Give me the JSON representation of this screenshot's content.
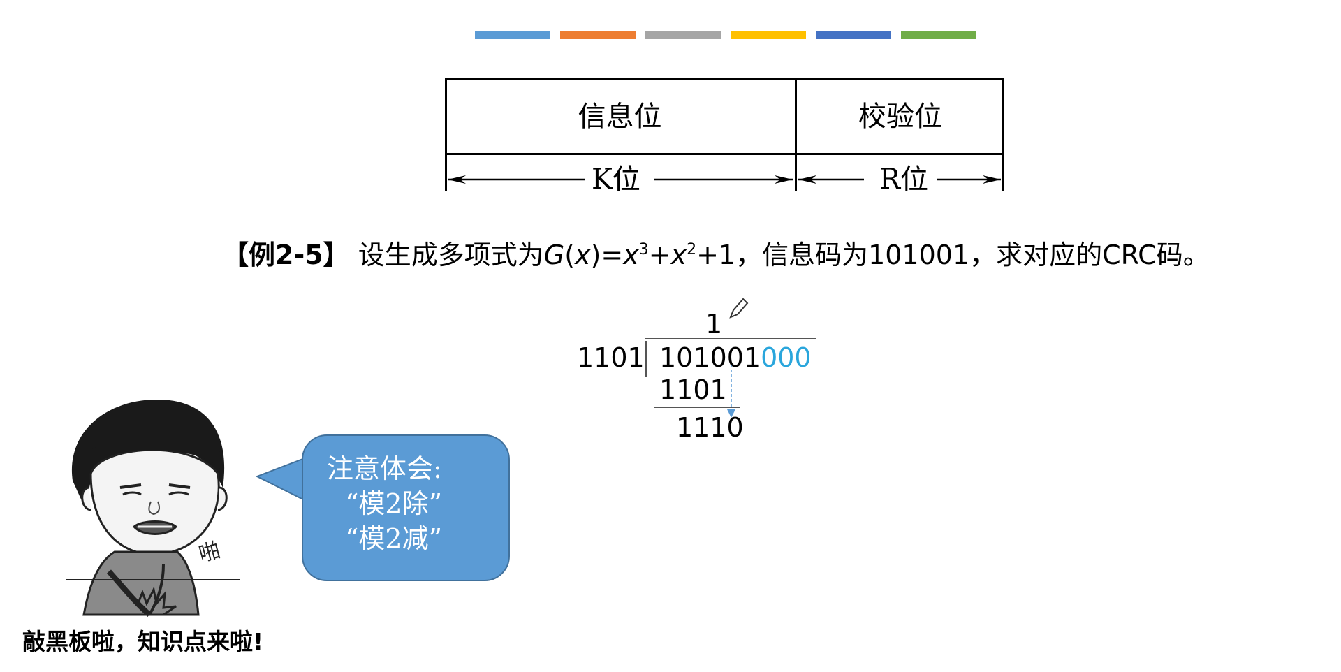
{
  "stripes": {
    "colors": [
      "#5b9bd5",
      "#ed7d31",
      "#a5a5a5",
      "#ffc000",
      "#4472c4",
      "#70ad47"
    ]
  },
  "frame": {
    "info_label": "信息位",
    "check_label": "校验位",
    "k_label": "K位",
    "r_label": "R位"
  },
  "example": {
    "tag": "【例2-5】",
    "prefix": "设生成多项式为",
    "g": "G",
    "x_paren_open": "(",
    "x": "x",
    "x_paren_close": ")=",
    "x1": "x",
    "exp1": "3",
    "plus1": "+",
    "x2": "x",
    "exp2": "2",
    "suffix": "+1，信息码为101001，求对应的CRC码。"
  },
  "division": {
    "quotient": "1",
    "divisor": "1101",
    "dividend_main": "101001",
    "dividend_pad": "000",
    "subtrahend": "1101",
    "remainder": "1110"
  },
  "bubble": {
    "line1": "注意体会:",
    "line2": "“模2除”",
    "line3": "“模2减”"
  },
  "meme": {
    "sound": "啪",
    "caption": "敲黑板啦，知识点来啦!"
  }
}
